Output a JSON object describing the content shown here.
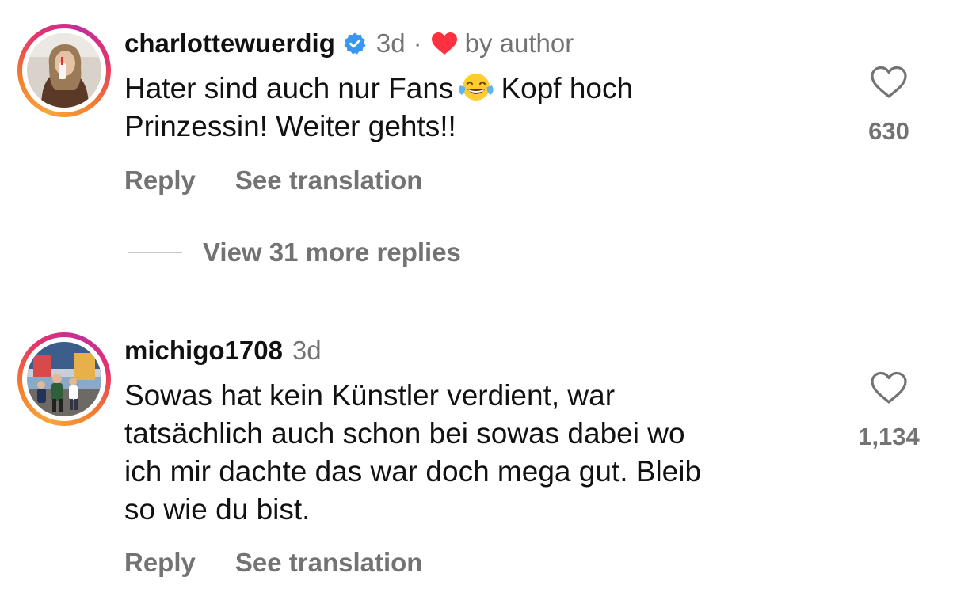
{
  "colors": {
    "text": "#111111",
    "muted": "#737373",
    "verified_blue": "#3897f0",
    "liked_red": "#ff3040",
    "ring_gradient": [
      "#f9a53c",
      "#e6336b",
      "#c02f9a"
    ]
  },
  "comments": [
    {
      "username": "charlottewuerdig",
      "verified": true,
      "time": "3d",
      "separator": "·",
      "liked_by_author_icon": "red-heart-icon",
      "liked_by_author_text": "by author",
      "text_line1_before_emoji": "Hater sind auch nur Fans",
      "emoji": "face-with-tears-of-joy-emoji",
      "text_line1_after_emoji": "Kopf hoch",
      "text_line2": "Prinzessin! Weiter gehts!!",
      "like_icon": "heart-outline-icon",
      "like_count": "630",
      "reply_label": "Reply",
      "translate_label": "See translation"
    },
    {
      "username": "michigo1708",
      "verified": false,
      "time": "3d",
      "text_lines": [
        "Sowas hat kein Künstler verdient, war",
        "tatsächlich auch schon bei sowas dabei wo",
        "ich mir dachte das war doch mega gut. Bleib",
        "so wie du bist."
      ],
      "like_icon": "heart-outline-icon",
      "like_count": "1,134",
      "reply_label": "Reply",
      "translate_label": "See translation"
    }
  ],
  "view_more_replies": "View 31 more replies"
}
